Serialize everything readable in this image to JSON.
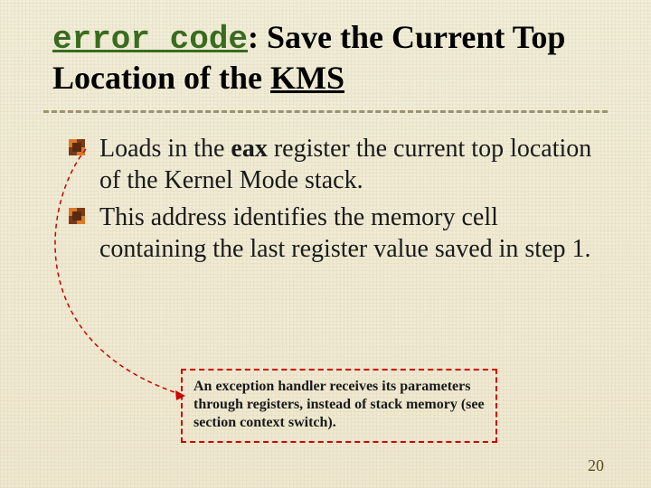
{
  "title": {
    "code": "error_code",
    "rest_before_kms": ": Save the Current Top Location of the ",
    "kms": "KMS"
  },
  "bullets": [
    {
      "pre": "Loads in the ",
      "bold": "eax",
      "post": " register the current top location of the Kernel Mode stack."
    },
    {
      "text": "This address identifies the memory cell containing the last register value saved in step 1."
    }
  ],
  "callout": "An exception handler receives its parameters through registers, instead of stack memory (see section context switch).",
  "page_number": "20",
  "icons": {
    "bullet": "square-pattern-bullet"
  },
  "colors": {
    "title_code": "#3a6b1f",
    "callout_border": "#cc0000",
    "divider": "#6b5a2a",
    "connector": "#cc0000"
  }
}
